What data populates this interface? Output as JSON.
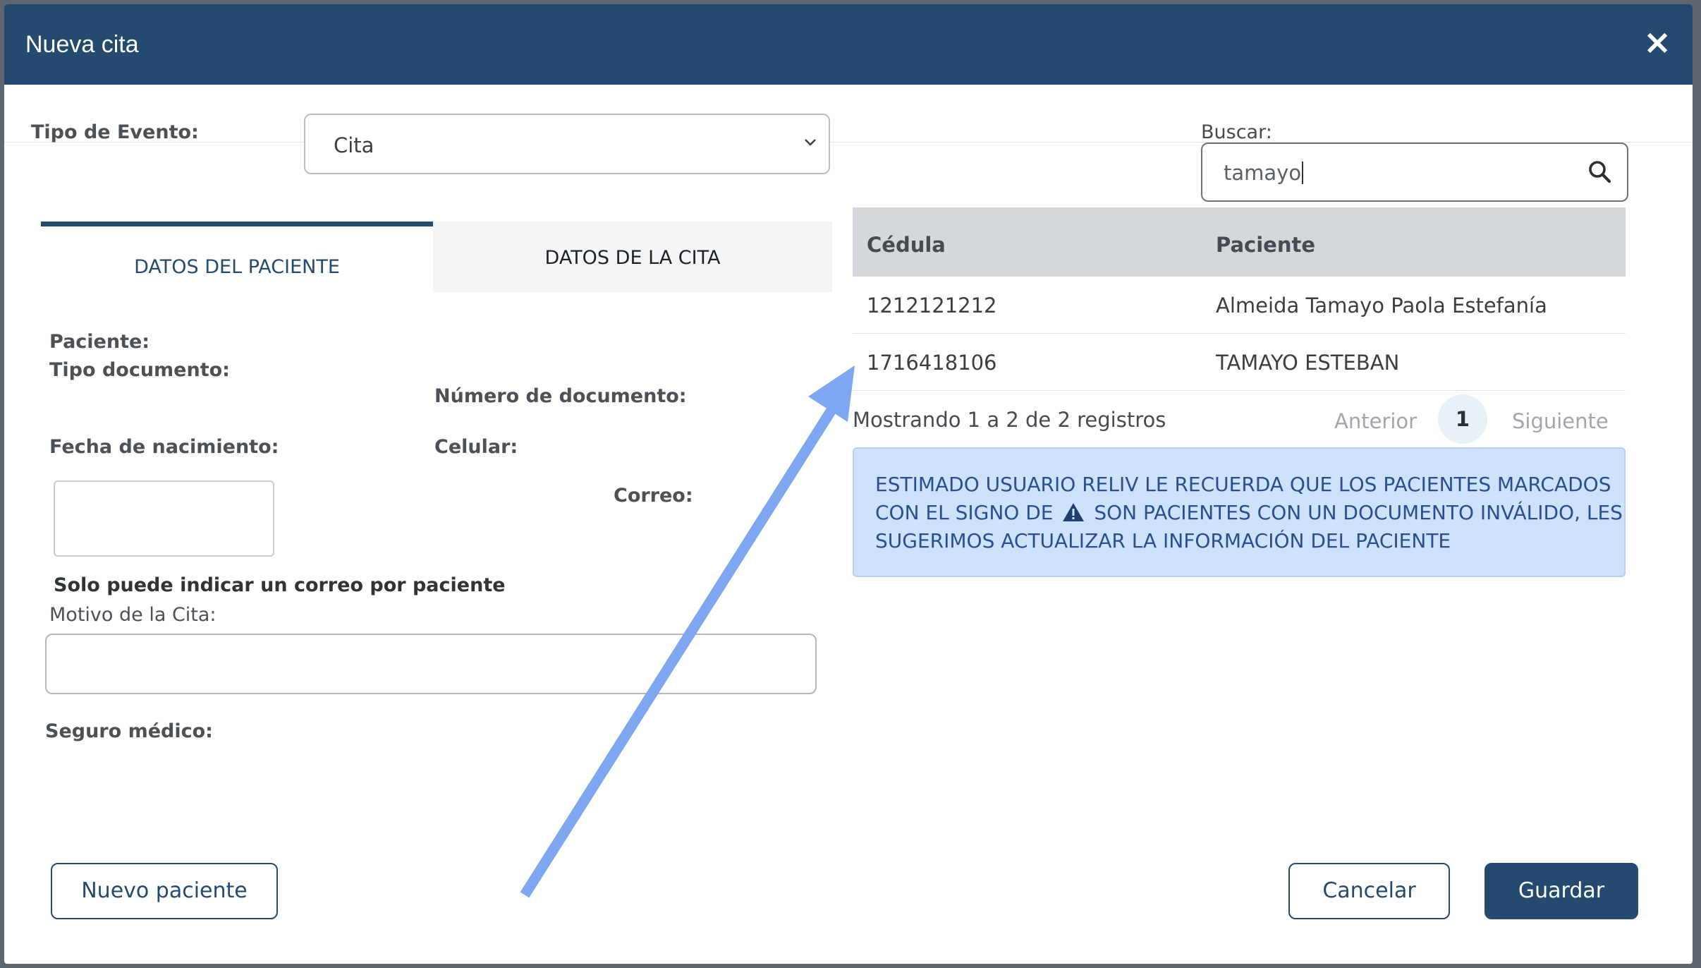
{
  "modal": {
    "title": "Nueva cita",
    "close_label": "×"
  },
  "evento": {
    "label": "Tipo de Evento:",
    "selected": "Cita"
  },
  "search": {
    "label": "Buscar:",
    "value": "tamayo"
  },
  "tabs": [
    {
      "label": "DATOS DEL PACIENTE",
      "active": true
    },
    {
      "label": "DATOS DE LA CITA",
      "active": false
    }
  ],
  "form": {
    "paciente_label": "Paciente:",
    "tipo_documento_label": "Tipo documento:",
    "numero_documento_label": "Número de documento:",
    "fecha_nacimiento_label": "Fecha de nacimiento:",
    "celular_label": "Celular:",
    "correo_label": "Correo:",
    "correo_note": "Solo puede indicar un correo por paciente",
    "motivo_label": "Motivo de la Cita:",
    "seguro_label": "Seguro médico:"
  },
  "table": {
    "headers": [
      "Cédula",
      "Paciente"
    ],
    "rows": [
      [
        "1212121212",
        "Almeida Tamayo Paola Estefanía"
      ],
      [
        "1716418106",
        "TAMAYO ESTEBAN"
      ]
    ]
  },
  "pagination": {
    "info": "Mostrando 1 a 2 de 2 registros",
    "prev": "Anterior",
    "current": "1",
    "next": "Siguiente"
  },
  "alert": {
    "line1": "ESTIMADO USUARIO RELIV LE RECUERDA QUE LOS PACIENTES MARCADOS",
    "line2_a": "CON EL SIGNO DE",
    "line2_b": "SON PACIENTES CON UN DOCUMENTO INVÁLIDO, LES",
    "line3": "SUGERIMOS ACTUALIZAR LA INFORMACIÓN DEL PACIENTE"
  },
  "buttons": {
    "nuevo_paciente": "Nuevo paciente",
    "cancelar": "Cancelar",
    "guardar": "Guardar"
  },
  "colors": {
    "header_bg": "#254a6f",
    "alert_bg": "#cfe2fb",
    "annotation_arrow": "#7fa6f0"
  },
  "icons": {
    "search": "search-icon",
    "warning": "warning-triangle-icon",
    "close": "close-icon",
    "select": "chevron-down-icon"
  }
}
